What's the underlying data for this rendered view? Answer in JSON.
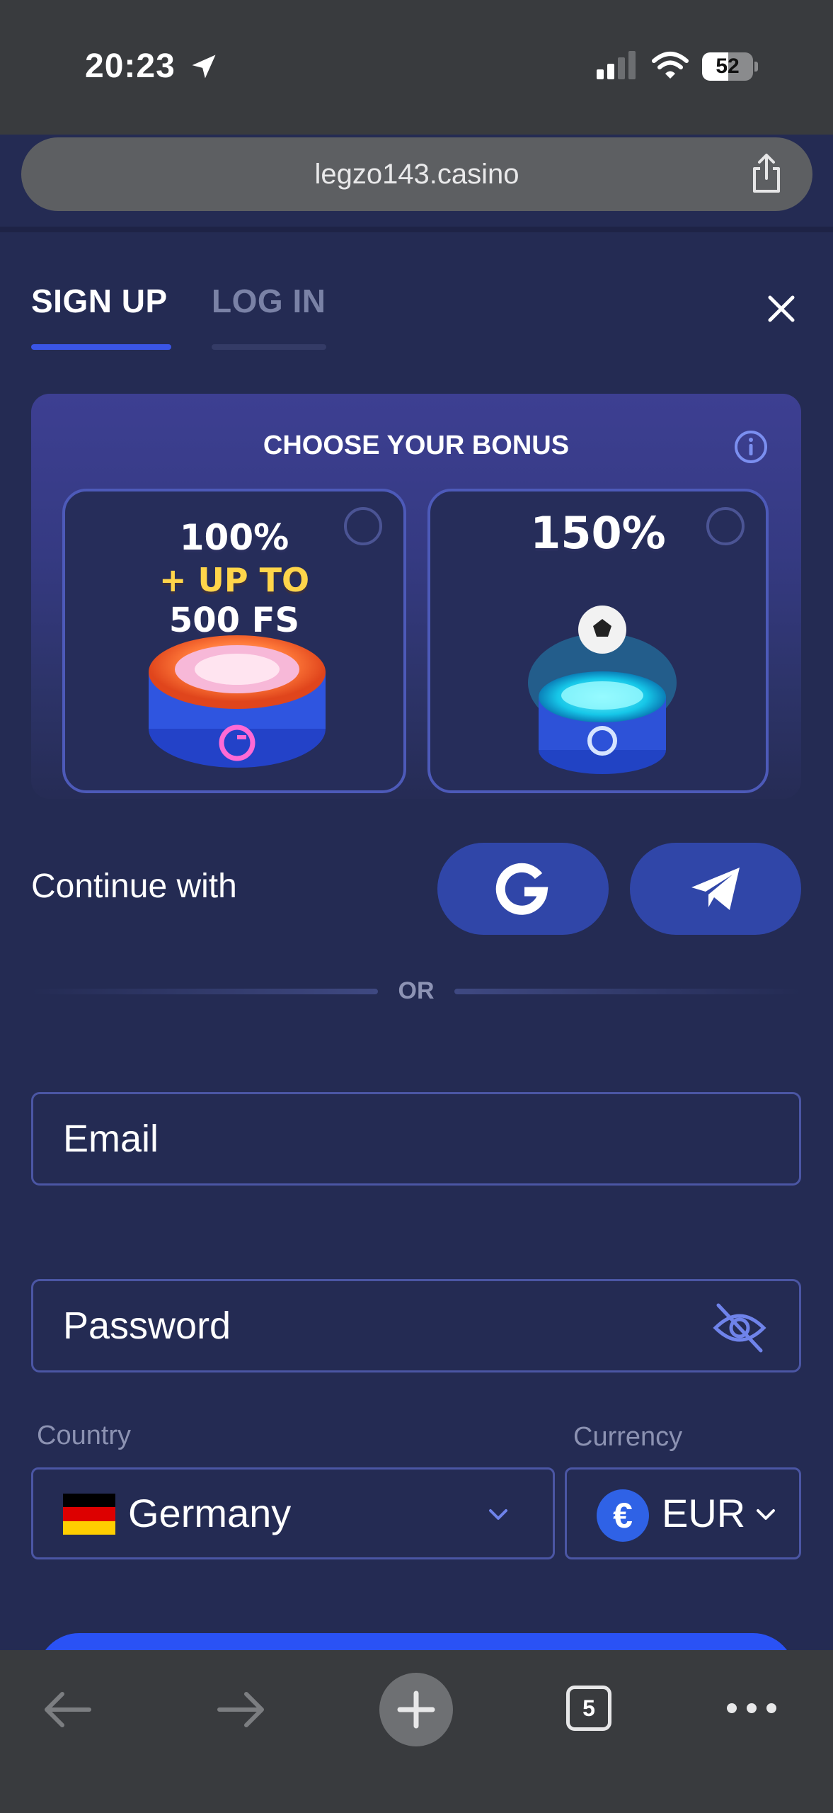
{
  "status_bar": {
    "time": "20:23",
    "battery": "52",
    "battery_level": 0.52
  },
  "browser": {
    "url": "legzo143.casino",
    "open_tabs": "5"
  },
  "auth_tabs": {
    "signup": "SIGN UP",
    "login": "LOG IN",
    "active": "signup"
  },
  "bonus": {
    "title": "CHOOSE YOUR BONUS",
    "options": [
      {
        "line1": "100%",
        "line2": "+ UP TO",
        "line3": "500 FS",
        "selected": false
      },
      {
        "line1": "150%",
        "selected": false
      }
    ]
  },
  "social": {
    "continue_label": "Continue with",
    "providers": [
      "google-icon",
      "telegram-icon"
    ]
  },
  "divider": {
    "text": "OR"
  },
  "form": {
    "email_placeholder": "Email",
    "password_placeholder": "Password",
    "country_label": "Country",
    "country_value": "Germany",
    "currency_label": "Currency",
    "currency_value": "EUR",
    "currency_symbol": "€"
  },
  "colors": {
    "background": "#242b53",
    "accent": "#3a55e6",
    "submit": "#2a52f5",
    "social_button": "#3046a8",
    "bonus_yellow": "#ffd54a"
  }
}
